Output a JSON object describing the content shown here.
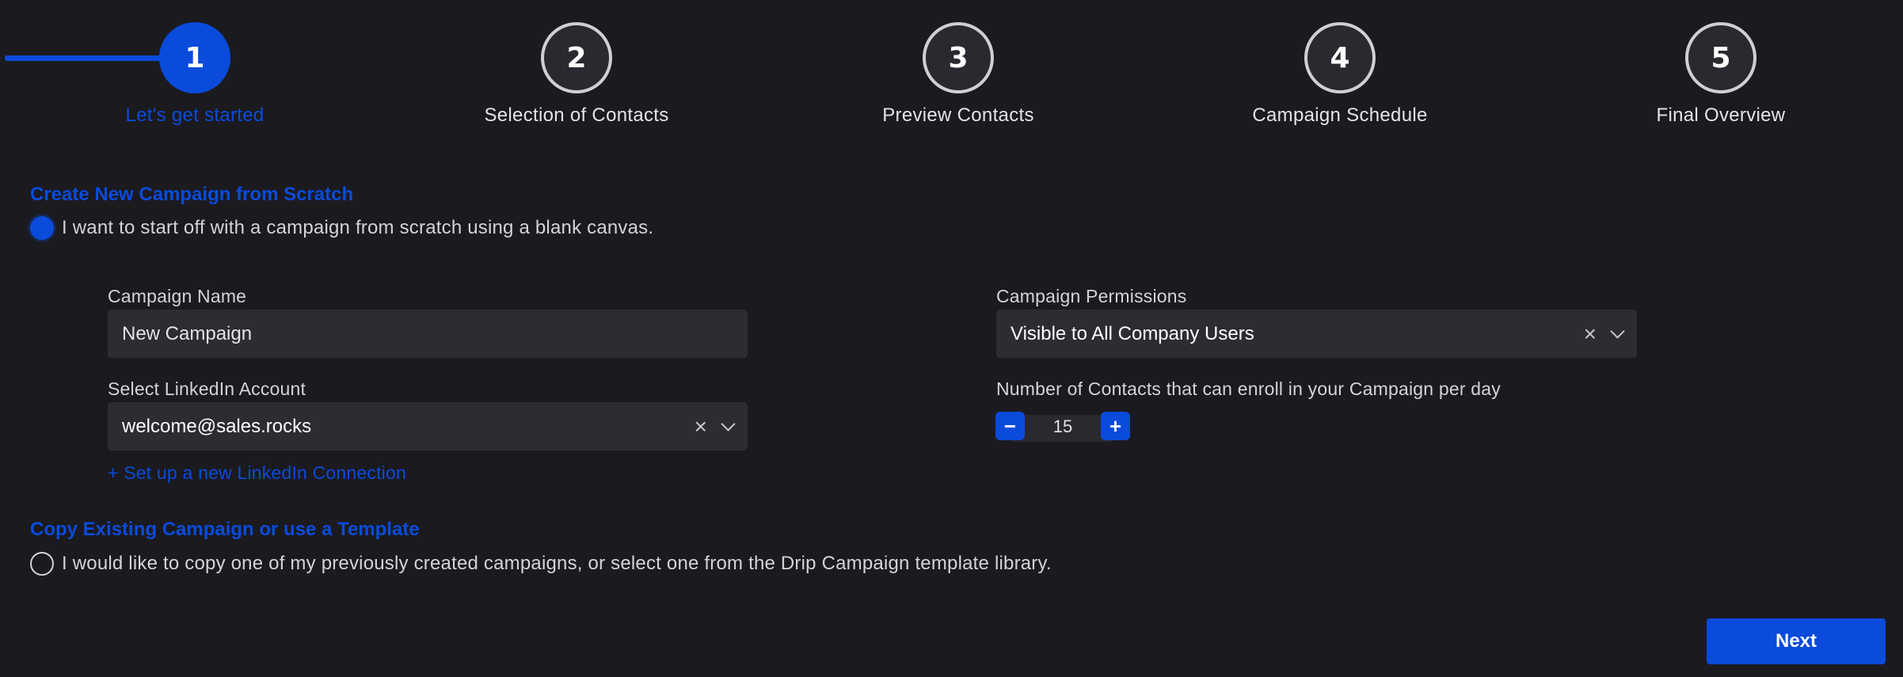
{
  "stepper": {
    "steps": [
      {
        "number": "1",
        "label": "Let's get started",
        "active": true
      },
      {
        "number": "2",
        "label": "Selection of Contacts",
        "active": false
      },
      {
        "number": "3",
        "label": "Preview Contacts",
        "active": false
      },
      {
        "number": "4",
        "label": "Campaign Schedule",
        "active": false
      },
      {
        "number": "5",
        "label": "Final Overview",
        "active": false
      }
    ]
  },
  "scratch": {
    "title": "Create New Campaign from Scratch",
    "option_text": "I want to start off with a campaign from scratch using a blank canvas.",
    "selected": true
  },
  "form": {
    "campaign_name_label": "Campaign Name",
    "campaign_name_value": "New Campaign",
    "permissions_label": "Campaign Permissions",
    "permissions_value": "Visible to All Company Users",
    "linkedin_label": "Select LinkedIn Account",
    "linkedin_value": "welcome@sales.rocks",
    "new_connection_link": "+ Set up a new LinkedIn Connection",
    "contacts_per_day_label": "Number of Contacts that can enroll in your Campaign per day",
    "contacts_per_day_value": "15",
    "minus_label": "−",
    "plus_label": "+",
    "clear_glyph": "×"
  },
  "copy": {
    "title": "Copy Existing Campaign or use a Template",
    "option_text": "I would like to copy one of my previously created campaigns, or select one from the Drip Campaign template library.",
    "selected": false
  },
  "footer": {
    "next_label": "Next"
  },
  "colors": {
    "accent": "#0a4bdb",
    "background": "#1b1a1f",
    "input_background": "#2d2c31"
  }
}
